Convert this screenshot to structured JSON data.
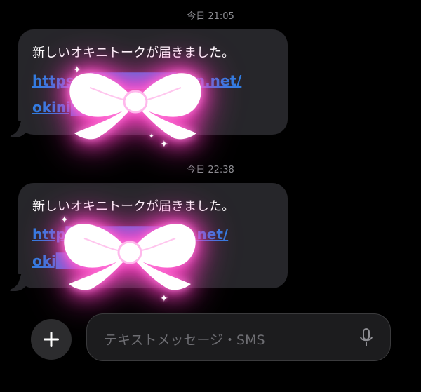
{
  "thread": {
    "messages": [
      {
        "timestamp": "今日 21:05",
        "text": "新しいオキニトークが届きました。",
        "link_line1": "https://████████ven.net/",
        "link_line2": "okini████"
      },
      {
        "timestamp": "今日 22:38",
        "text": "新しいオキニトークが届きました。",
        "link_line1": "http█████████ven.net/",
        "link_line2": "oki████ik"
      }
    ]
  },
  "composer": {
    "placeholder": "テキストメッセージ・SMS",
    "add_icon": "plus-icon",
    "mic_icon": "microphone-icon"
  },
  "overlay": {
    "sticker": "pink-glowing-bow-sticker",
    "glow_color": "#ff4fc8"
  },
  "colors": {
    "bubble": "#26262a",
    "link": "#2f7de1",
    "background": "#000000"
  }
}
